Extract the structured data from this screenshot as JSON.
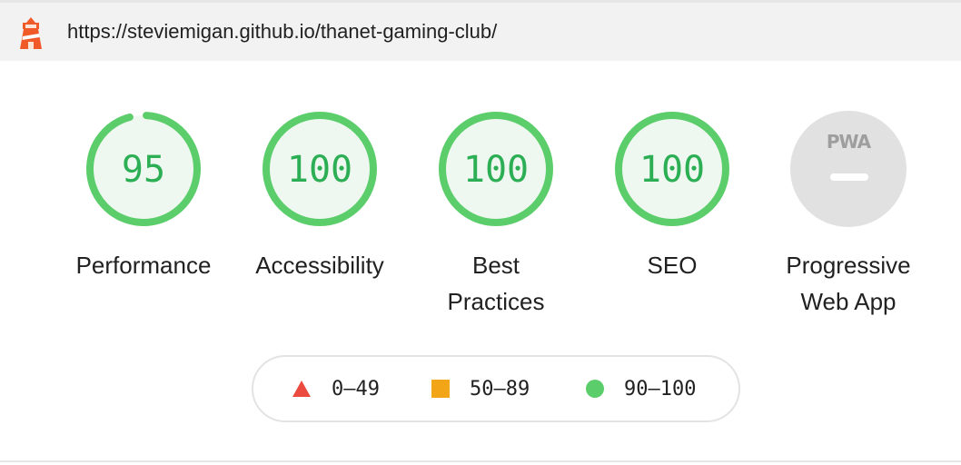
{
  "header": {
    "url": "https://steviemigan.github.io/thanet-gaming-club/",
    "logo_icon": "lighthouse-icon"
  },
  "gauges": [
    {
      "id": "performance",
      "label": "Performance",
      "score": "95",
      "value": 0.95
    },
    {
      "id": "accessibility",
      "label": "Accessibility",
      "score": "100",
      "value": 1.0
    },
    {
      "id": "best-practices",
      "label_line1": "Best",
      "label_line2": "Practices",
      "score": "100",
      "value": 1.0
    },
    {
      "id": "seo",
      "label": "SEO",
      "score": "100",
      "value": 1.0
    },
    {
      "id": "pwa",
      "label_line1": "Progressive",
      "label_line2": "Web App",
      "badge": "PWA"
    }
  ],
  "legend": [
    {
      "icon": "triangle-icon",
      "range": "0–49",
      "color": "#eb4a3f"
    },
    {
      "icon": "square-icon",
      "range": "50–89",
      "color": "#f2a516"
    },
    {
      "icon": "circle-icon",
      "range": "90–100",
      "color": "#5ccd6b"
    }
  ],
  "colors": {
    "pass_ring": "#5ccd6b",
    "pass_text": "#2cae54",
    "pass_fill": "#eef8f0",
    "pwa_bg": "#e1e1e1"
  }
}
